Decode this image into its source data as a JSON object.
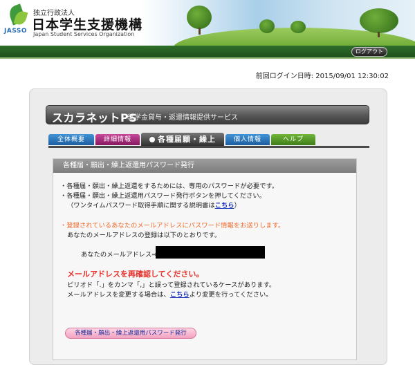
{
  "header": {
    "org_sub": "独立行政法人",
    "org_name": "日本学生支援機構",
    "org_en": "Japan Student Services Organization",
    "logo_text": "JASSO",
    "logout_label": "ログアウト"
  },
  "last_login": "前回ログイン日時: 2015/09/01 12:30:02",
  "title": {
    "main": "スカラネットPS",
    "sub": "奨学金貸与・返還情報提供サービス"
  },
  "tabs": [
    {
      "label": "全体概要",
      "color": "#2a78bd"
    },
    {
      "label": "詳細情報",
      "color": "#a62a7c"
    },
    {
      "label": "各種届願・繰上",
      "color": "#3a3a3a",
      "active": true
    },
    {
      "label": "個人情報",
      "color": "#2a78bd"
    },
    {
      "label": "ヘルプ",
      "color": "#5a9a2a"
    }
  ],
  "section": {
    "heading": "各種届・願出・繰上返還用パスワード発行",
    "line1": "・各種届・願出・繰上返還をするためには、専用のパスワードが必要です。",
    "line2": "・各種届・願出・繰上返還用パスワード発行ボタンを押してください。",
    "line3a": "（ワンタイムパスワード取得手順に関する説明書は",
    "line3_link": "こちら",
    "line3b": "）",
    "notice1": "・登録されているあなたのメールアドレスにパスワード情報をお送りします。",
    "notice2": "あなたのメールアドレスの登録は以下のとおりです。",
    "email_label": "あなたのメールアドレス⇒",
    "reconfirm": "メールアドレスを再確認してください。",
    "warn1": "ピリオド「.」をカンマ「,」と誤って登録されているケースがあります。",
    "warn2a": "メールアドレスを変更する場合は、",
    "warn2_link": "こちら",
    "warn2b": "より変更を行ってください。",
    "issue_button": "各種届・願出・繰上返還用パスワード発行"
  },
  "colors": {
    "accent_green": "#1f4f1c",
    "notice_orange": "#f06a2a",
    "alert_red": "#e8302a",
    "link_blue": "#1a35b8"
  }
}
